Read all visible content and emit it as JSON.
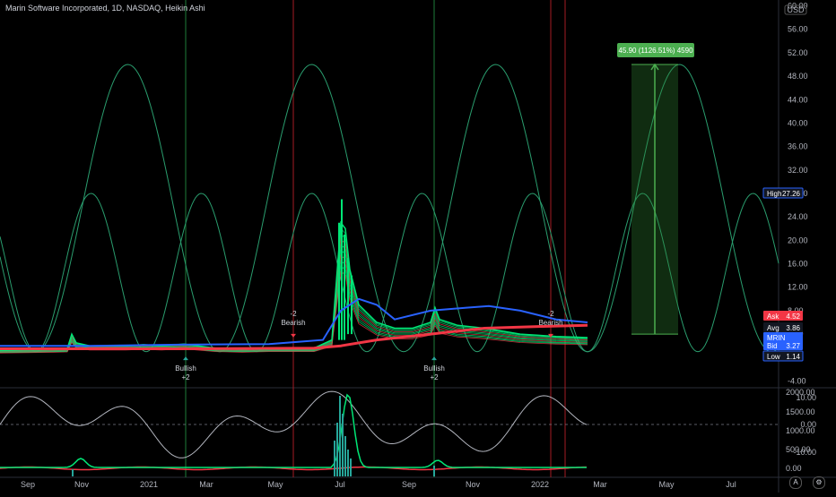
{
  "title": "Marin Software Incorporated, 1D, NASDAQ, Heikin Ashi",
  "currency": "USD",
  "chart_data": {
    "type": "line",
    "price_axis": {
      "ticks": [
        60,
        56,
        52,
        48,
        44,
        40,
        36,
        32,
        28,
        24,
        20,
        16,
        12,
        8,
        4,
        -4
      ],
      "labels": [
        "60.00",
        "56.00",
        "52.00",
        "48.00",
        "44.00",
        "40.00",
        "36.00",
        "32.00",
        "28.00",
        "24.00",
        "20.00",
        "16.00",
        "12.00",
        "8.00",
        "4.00",
        "-4.00"
      ],
      "ylim": [
        -5,
        61
      ]
    },
    "time_axis": {
      "labels": [
        "Sep",
        "Nov",
        "2021",
        "Mar",
        "May",
        "Jul",
        "Sep",
        "Nov",
        "2022",
        "Mar",
        "May",
        "Jul"
      ]
    },
    "price_series": [
      {
        "name": "price",
        "color": "#26a69a",
        "values": [
          [
            0,
            1.2
          ],
          [
            30,
            1.3
          ],
          [
            60,
            1.4
          ],
          [
            75,
            1.5
          ],
          [
            80,
            4.0
          ],
          [
            85,
            2.5
          ],
          [
            100,
            2.0
          ],
          [
            140,
            2.0
          ],
          [
            160,
            2.2
          ],
          [
            180,
            2.0
          ],
          [
            205,
            2.3
          ],
          [
            240,
            1.6
          ],
          [
            270,
            1.4
          ],
          [
            300,
            1.6
          ],
          [
            330,
            1.6
          ],
          [
            350,
            1.6
          ],
          [
            370,
            3.0
          ],
          [
            380,
            23.0
          ],
          [
            385,
            22.0
          ],
          [
            390,
            15.0
          ],
          [
            400,
            9.0
          ],
          [
            420,
            6.0
          ],
          [
            440,
            5.0
          ],
          [
            460,
            5.0
          ],
          [
            480,
            6.0
          ],
          [
            485,
            8.5
          ],
          [
            490,
            6.5
          ],
          [
            510,
            5.5
          ],
          [
            540,
            5.0
          ],
          [
            560,
            4.5
          ],
          [
            580,
            4.0
          ],
          [
            600,
            3.8
          ],
          [
            620,
            3.6
          ],
          [
            640,
            3.5
          ],
          [
            655,
            3.4
          ]
        ]
      }
    ],
    "overlays": [
      {
        "name": "blue-ma",
        "color": "#2962ff",
        "values": [
          [
            0,
            2.0
          ],
          [
            100,
            2.0
          ],
          [
            200,
            2.2
          ],
          [
            300,
            2.3
          ],
          [
            360,
            3.0
          ],
          [
            380,
            8.0
          ],
          [
            400,
            10.0
          ],
          [
            420,
            9.0
          ],
          [
            440,
            6.5
          ],
          [
            480,
            8.0
          ],
          [
            520,
            8.5
          ],
          [
            545,
            8.8
          ],
          [
            580,
            8.0
          ],
          [
            620,
            6.5
          ],
          [
            655,
            6.0
          ]
        ]
      },
      {
        "name": "red-ma",
        "color": "#f23645",
        "values": [
          [
            0,
            1.5
          ],
          [
            200,
            1.5
          ],
          [
            350,
            1.6
          ],
          [
            380,
            2.0
          ],
          [
            420,
            3.0
          ],
          [
            480,
            4.0
          ],
          [
            540,
            5.0
          ],
          [
            600,
            5.3
          ],
          [
            655,
            5.5
          ]
        ]
      }
    ],
    "cycle_high": {
      "period": 205,
      "peak": 50,
      "trough": 1,
      "phase": 40,
      "color": "#2a9d6e"
    },
    "cycle_low": {
      "period": 123,
      "peak": 28,
      "trough": 1,
      "phase": 40,
      "color": "#2a9d6e"
    },
    "vertical_lines": [
      {
        "x": 207,
        "color": "#1e7d3a"
      },
      {
        "x": 327,
        "color": "#a51d24"
      },
      {
        "x": 484,
        "color": "#1e7d3a"
      },
      {
        "x": 614,
        "color": "#a51d24"
      },
      {
        "x": 630,
        "color": "#a51d24"
      }
    ],
    "signals": [
      {
        "label_top": "Bullish",
        "label_bottom": "+2",
        "x": 207,
        "direction": "up",
        "color": "#26a69a"
      },
      {
        "label_top": "-2",
        "label_bottom": "Bearish",
        "x": 327,
        "direction": "down",
        "color": "#f23645"
      },
      {
        "label_top": "Bullish",
        "label_bottom": "+2",
        "x": 484,
        "direction": "up",
        "color": "#26a69a"
      },
      {
        "label_top": "-2",
        "label_bottom": "Bearish",
        "x": 614,
        "direction": "down",
        "color": "#f23645"
      }
    ],
    "projection": {
      "label": "45.90 (1126.51%) 4590",
      "from": 4.0,
      "to": 50.0,
      "color": "#2e7d32"
    },
    "price_badges": [
      {
        "label": "High",
        "value": "27.26",
        "price": 27.26,
        "color": "#131722",
        "border": "#2962ff"
      },
      {
        "label": "Ask",
        "value": "4.52",
        "price": 4.52,
        "color": "#f23645"
      },
      {
        "label": "Avg",
        "value": "3.86",
        "price": 3.86,
        "color": "#131722"
      },
      {
        "label": "MRIN",
        "value": "",
        "price": 3.5,
        "color": "#2962ff"
      },
      {
        "label": "Bid",
        "value": "3.27",
        "price": 3.27,
        "color": "#2962ff"
      },
      {
        "label": "Low",
        "value": "1.14",
        "price": 1.14,
        "color": "#131722",
        "border": "#2962ff"
      }
    ],
    "oscillator": {
      "right_ticks": [
        "2000.00",
        "1500.00",
        "1000.00",
        "500.00",
        "0.00"
      ],
      "left_ticks": [
        "10.00",
        "0.00",
        "-10.00"
      ]
    }
  }
}
